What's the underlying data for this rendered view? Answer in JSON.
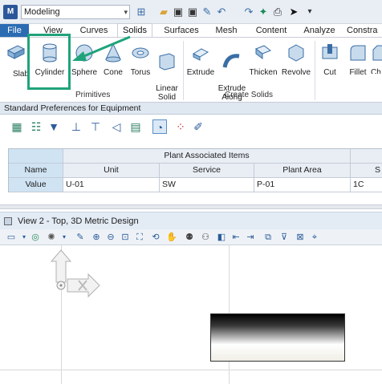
{
  "quick_access": {
    "workspace": "Modeling",
    "icons": [
      "view-icon",
      "folder-icon",
      "save-icon",
      "save-all-icon",
      "new-icon",
      "undo-icon",
      "redo-icon",
      "pin-icon",
      "print-icon",
      "select-icon",
      "more-icon"
    ]
  },
  "tabs": [
    "File",
    "View",
    "Curves",
    "Solids",
    "Surfaces",
    "Mesh",
    "Content",
    "Analyze",
    "Constra"
  ],
  "active_tab": "Solids",
  "ribbon": {
    "tools": [
      {
        "label": "Slab",
        "icon": "slab-icon"
      },
      {
        "label": "Cylinder",
        "icon": "cylinder-icon"
      },
      {
        "label": "Sphere",
        "icon": "sphere-icon"
      },
      {
        "label": "Cone",
        "icon": "cone-icon"
      },
      {
        "label": "Torus",
        "icon": "torus-icon"
      },
      {
        "label": "Linear\nSolid",
        "icon": "linear-solid-icon"
      },
      {
        "label": "Extrude",
        "icon": "extrude-icon"
      },
      {
        "label": "Extrude\nAlong",
        "icon": "extrude-along-icon"
      },
      {
        "label": "Thicken",
        "icon": "thicken-icon"
      },
      {
        "label": "Revolve",
        "icon": "revolve-icon"
      },
      {
        "label": "Cut",
        "icon": "cut-icon"
      },
      {
        "label": "Fillet",
        "icon": "fillet-icon"
      },
      {
        "label": "Ch",
        "icon": "chamfer-icon"
      }
    ],
    "groups": [
      "Primitives",
      "Create Solids"
    ]
  },
  "panel": {
    "title": "Standard Preferences for Equipment",
    "table": {
      "group_header": "Plant Associated Items",
      "columns": [
        "Name",
        "Unit",
        "Service",
        "Plant Area",
        "S"
      ],
      "row": {
        "label": "Value",
        "values": [
          "U-01",
          "SW",
          "P-01",
          "1C"
        ]
      }
    }
  },
  "view": {
    "title": "View 2 - Top, 3D Metric Design"
  },
  "colors": {
    "accent": "#2b6cb3",
    "highlight": "#1fa37a"
  }
}
